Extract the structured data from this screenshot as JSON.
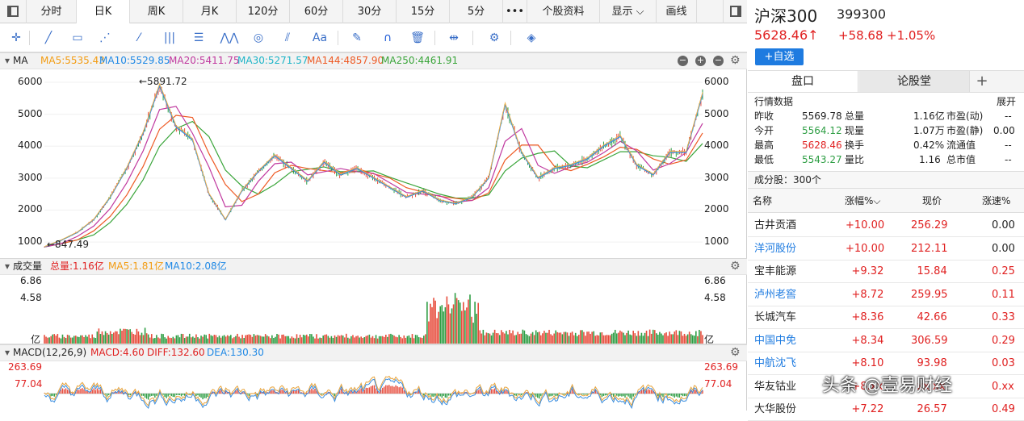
{
  "tabs": [
    {
      "label": "",
      "icon": "sidebar-toggle-icon"
    },
    {
      "label": "分时"
    },
    {
      "label": "日K"
    },
    {
      "label": "周K"
    },
    {
      "label": "月K"
    },
    {
      "label": "120分"
    },
    {
      "label": "60分"
    },
    {
      "label": "30分"
    },
    {
      "label": "15分"
    },
    {
      "label": "5分"
    },
    {
      "label": "•••"
    },
    {
      "label": "个股资料"
    },
    {
      "label": "显示 ⌵"
    },
    {
      "label": "画线"
    }
  ],
  "active_tab": "日K",
  "tools": [
    "move-icon",
    "line-icon",
    "rectangle-icon",
    "fan-icon",
    "node-line-icon",
    "parallel-lines-icon",
    "channel-icon",
    "wave-icon",
    "cycle-icon",
    "fibonacci-icon",
    "text-icon",
    "eraser-icon",
    "magnet-icon",
    "trash-icon",
    "zoom-horizontal-icon",
    "settings-icon",
    "layers-icon"
  ],
  "text_tool_label": "Aa",
  "ma": {
    "name": "MA",
    "items": [
      {
        "label": "MA5:5535.43",
        "color": "#f39c12"
      },
      {
        "label": "MA10:5529.85",
        "color": "#1e88e5"
      },
      {
        "label": "MA20:5411.75",
        "color": "#c0399f"
      },
      {
        "label": "MA30:5271.57",
        "color": "#1fb5c8"
      },
      {
        "label": "MA144:4857.90",
        "color": "#ee5a24"
      },
      {
        "label": "MA250:4461.91",
        "color": "#3aa53a"
      }
    ]
  },
  "ma_axis": [
    "6000",
    "5000",
    "4000",
    "3000",
    "2000",
    "1000"
  ],
  "annot_high": "←5891.72",
  "annot_low": "←847.49",
  "vol": {
    "name": "成交量",
    "items": [
      {
        "label": "总量:1.16亿",
        "color": "#e02020"
      },
      {
        "label": "MA5:1.81亿",
        "color": "#f39c12"
      },
      {
        "label": "MA10:2.08亿",
        "color": "#1e88e5"
      }
    ],
    "axis": [
      "6.86",
      "4.58",
      "亿"
    ]
  },
  "macd": {
    "name": "MACD(12,26,9)",
    "items": [
      {
        "label": "MACD:4.60",
        "color": "#e02020"
      },
      {
        "label": "DIFF:132.60",
        "color": "#e02020"
      },
      {
        "label": "DEA:130.30",
        "color": "#1e88e5"
      }
    ],
    "axis": [
      "263.69",
      "77.04"
    ]
  },
  "stock": {
    "name": "沪深300",
    "code": "399300",
    "price": "5628.46↑",
    "change": "+58.68",
    "pct": "+1.05%",
    "watch": "+自选"
  },
  "subtabs": [
    "盘口",
    "论股堂",
    "+"
  ],
  "quote_title": "行情数据",
  "quote_expand": "展开",
  "quote": [
    [
      "昨收",
      "5569.78",
      "总量",
      "1.16亿",
      "市盈(动)",
      "--"
    ],
    [
      "今开",
      "5564.12",
      "现量",
      "1.07万",
      "市盈(静)",
      "0.00"
    ],
    [
      "最高",
      "5628.46",
      "换手",
      "0.42%",
      "流通值",
      "--"
    ],
    [
      "最低",
      "5543.27",
      "量比",
      "1.16",
      "总市值",
      "--"
    ]
  ],
  "constituents": "成分股：300个",
  "list_header": [
    "名称",
    "涨幅%⌵",
    "现价",
    "涨速%"
  ],
  "list": [
    [
      "古井贡酒",
      "+10.00",
      "256.29",
      "0.00"
    ],
    [
      "洋河股份",
      "+10.00",
      "212.11",
      "0.00"
    ],
    [
      "宝丰能源",
      "+9.32",
      "15.84",
      "0.25"
    ],
    [
      "泸州老窖",
      "+8.72",
      "259.95",
      "0.11"
    ],
    [
      "长城汽车",
      "+8.36",
      "42.66",
      "0.33"
    ],
    [
      "中国中免",
      "+8.34",
      "306.59",
      "0.29"
    ],
    [
      "中航沈飞",
      "+8.10",
      "93.98",
      "0.03"
    ],
    [
      "华友钴业",
      "+8.xx",
      "xx.xx",
      "0.xx"
    ],
    [
      "大华股份",
      "+7.22",
      "26.57",
      "0.49"
    ]
  ],
  "watermark": "头条 @壹易财经",
  "chart_data": {
    "type": "line",
    "x": [
      0,
      20,
      40,
      60,
      80,
      100,
      120,
      140,
      160,
      180,
      200,
      220,
      240,
      260,
      280,
      300,
      320,
      340,
      360,
      380,
      400,
      420,
      440,
      460,
      480,
      500,
      520,
      540,
      560,
      580,
      600,
      620,
      640,
      660,
      680,
      700,
      720,
      740,
      760,
      780,
      800
    ],
    "series": [
      {
        "name": "沪深300",
        "values": [
          847,
          1050,
          1300,
          1700,
          2400,
          3300,
          4400,
          5891,
          4600,
          4200,
          2500,
          1700,
          2600,
          3200,
          3700,
          3300,
          2900,
          3500,
          3100,
          3300,
          3000,
          2700,
          2400,
          2600,
          2300,
          2200,
          2400,
          3000,
          5300,
          3800,
          3000,
          3300,
          3400,
          3600,
          4000,
          4300,
          3400,
          3100,
          3800,
          3800,
          5628
        ]
      }
    ],
    "ylim": [
      800,
      6100
    ],
    "volume_ylim": [
      0,
      6.86
    ],
    "macd_ylim": [
      -160,
      263.69
    ]
  }
}
